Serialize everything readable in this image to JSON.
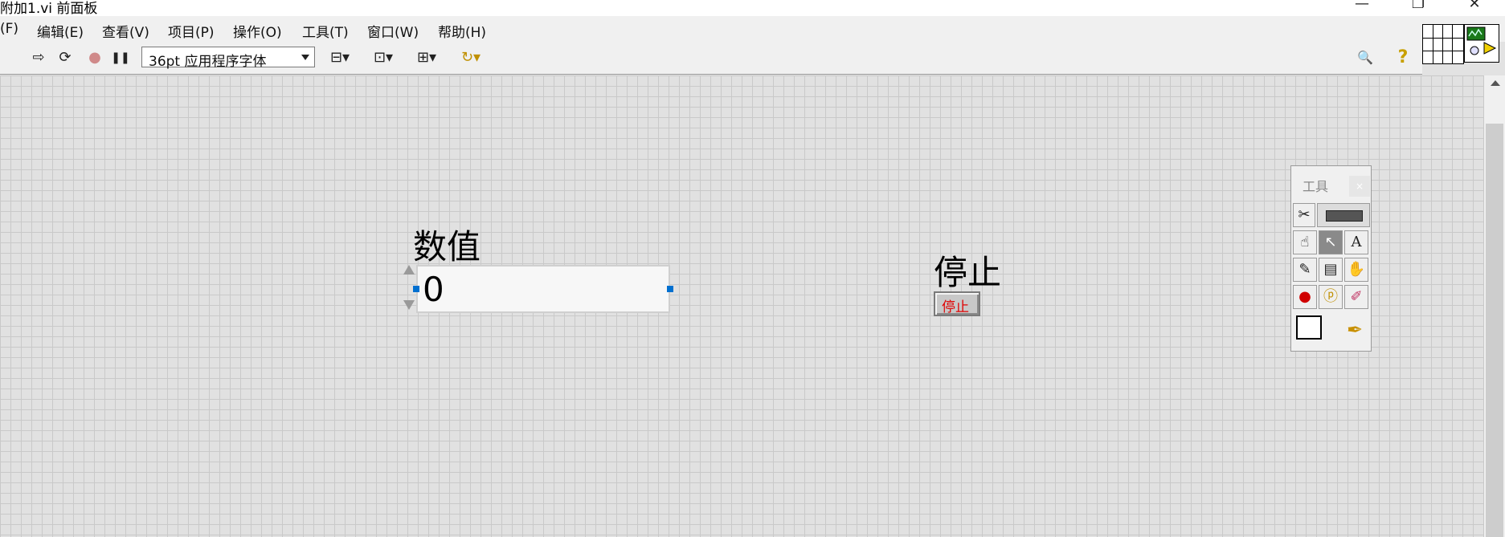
{
  "window": {
    "title": "附加1.vi 前面板",
    "minimize": "—",
    "restore": "❐",
    "close": "✕"
  },
  "menu": [
    {
      "label": "(F)",
      "name": "menu-file"
    },
    {
      "label": "编辑(E)",
      "name": "menu-edit"
    },
    {
      "label": "查看(V)",
      "name": "menu-view"
    },
    {
      "label": "项目(P)",
      "name": "menu-project"
    },
    {
      "label": "操作(O)",
      "name": "menu-operate"
    },
    {
      "label": "工具(T)",
      "name": "menu-tools"
    },
    {
      "label": "窗口(W)",
      "name": "menu-window"
    },
    {
      "label": "帮助(H)",
      "name": "menu-help"
    }
  ],
  "toolbar": {
    "font_select_value": "36pt 应用程序字体",
    "icons": {
      "run": "⇨",
      "run_continuous": "⟳",
      "abort": "●",
      "pause": "❚❚",
      "align": "⊟▾",
      "distribute": "⊡▾",
      "resize": "⊞▾",
      "reorder": "↻▾",
      "search": "🔍",
      "help": "?"
    }
  },
  "front_panel": {
    "numeric_control": {
      "label": "数值",
      "value": "0"
    },
    "stop_button": {
      "label": "停止",
      "text": "停止",
      "text_color": "#e00000"
    }
  },
  "tools_palette": {
    "title": "工具",
    "close": "×",
    "tools": [
      {
        "name": "operate-value-tool",
        "glyph": "☝"
      },
      {
        "name": "position-select-tool",
        "glyph": "↖",
        "selected": true
      },
      {
        "name": "edit-text-tool",
        "glyph": "A"
      },
      {
        "name": "connect-wire-tool",
        "glyph": "✎"
      },
      {
        "name": "object-shortcut-menu-tool",
        "glyph": "▤"
      },
      {
        "name": "scroll-window-tool",
        "glyph": "✋"
      },
      {
        "name": "breakpoint-tool",
        "glyph": "●"
      },
      {
        "name": "probe-tool",
        "glyph": "ⓟ"
      },
      {
        "name": "get-color-tool",
        "glyph": "✐"
      },
      {
        "name": "set-color-tool",
        "glyph": "✒"
      }
    ]
  }
}
